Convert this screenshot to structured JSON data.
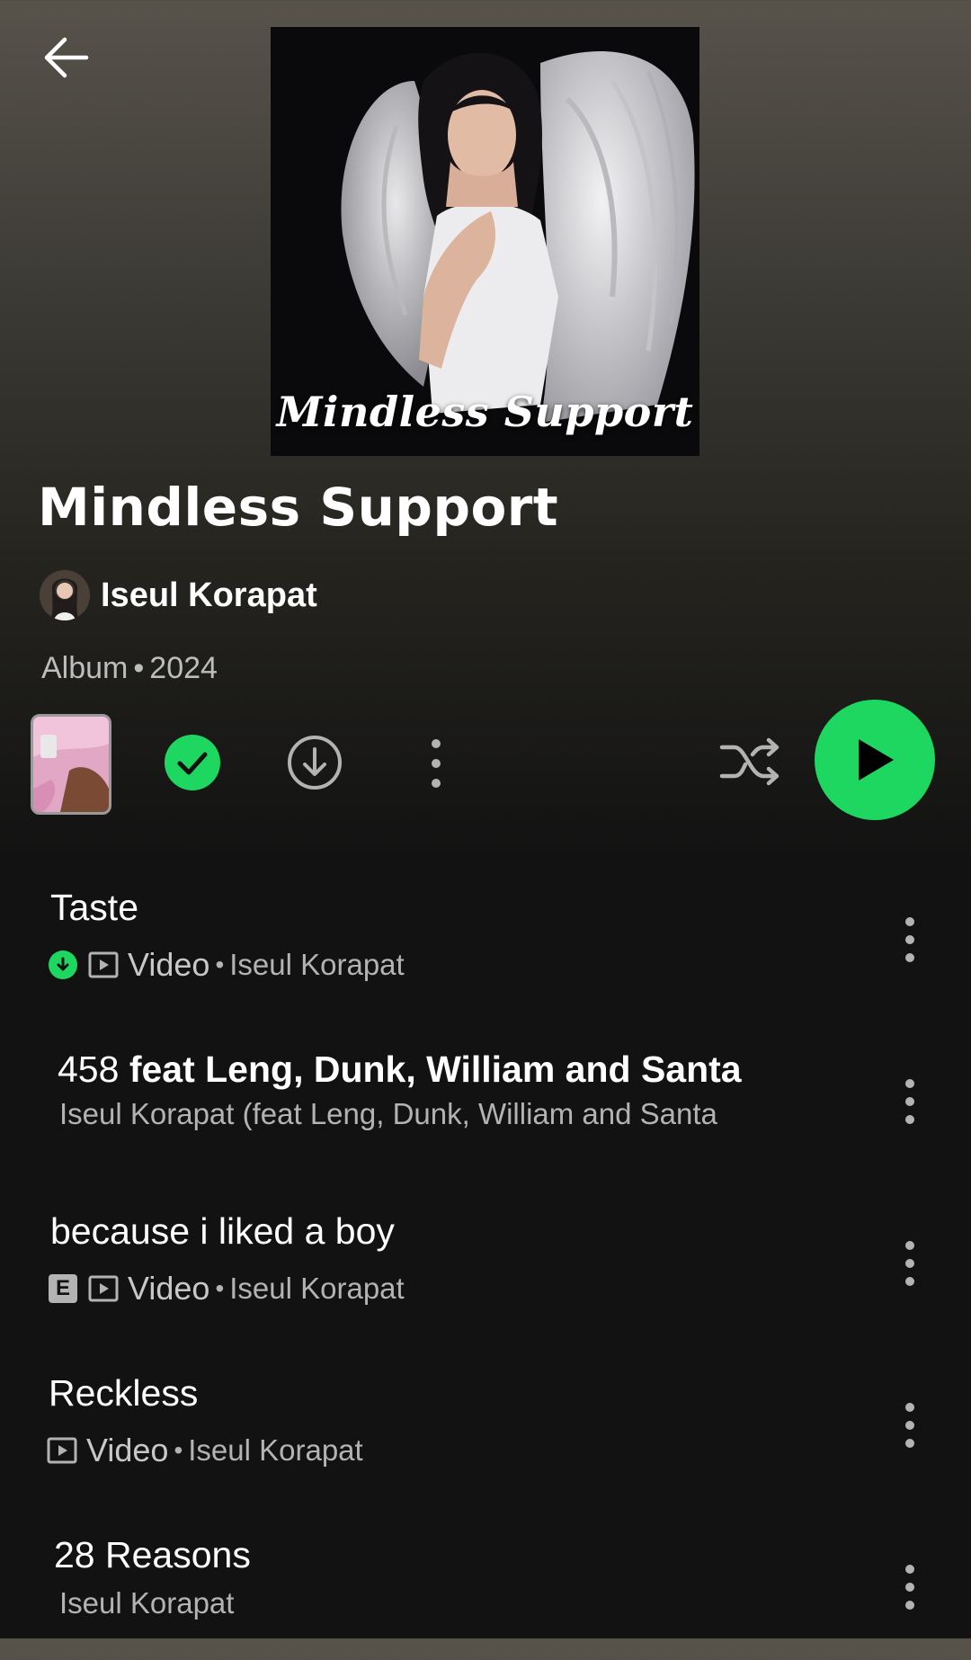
{
  "header": {
    "back_icon": "arrow-left-icon"
  },
  "album": {
    "cover_text": "Mindless Support",
    "title": "Mindless Support",
    "artist": "Iseul Korapat",
    "type": "Album",
    "separator": "•",
    "year": "2024"
  },
  "controls": {
    "icons": [
      "preview-thumbnail",
      "check-circle-icon",
      "download-icon",
      "more-vertical-icon",
      "shuffle-icon",
      "play-icon"
    ],
    "accent_color": "#1ed760"
  },
  "tracks": [
    {
      "title": "Taste",
      "downloaded": true,
      "explicit": false,
      "video": true,
      "type_label": "Video",
      "separator": "•",
      "artist": "Iseul Korapat"
    },
    {
      "title_number": "458",
      "title_rest": "feat Leng, Dunk, William and Santa",
      "subtitle": "Iseul Korapat (feat Leng, Dunk, William and Santa"
    },
    {
      "title": "because i liked a boy",
      "explicit_label": "E",
      "video": true,
      "type_label": "Video",
      "separator": "•",
      "artist": "Iseul Korapat"
    },
    {
      "title": "Reckless",
      "video": true,
      "type_label": "Video",
      "separator": "•",
      "artist": "Iseul Korapat"
    },
    {
      "title": "28 Reasons",
      "subtitle": "Iseul Korapat"
    }
  ]
}
